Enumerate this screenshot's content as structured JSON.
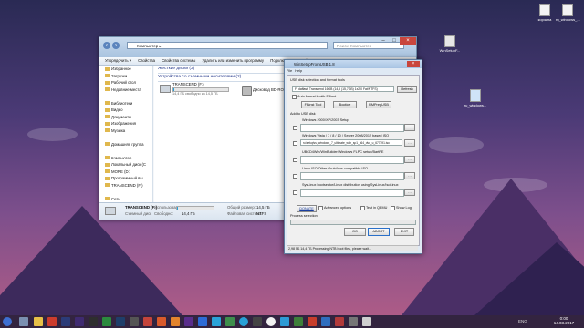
{
  "desktop": {
    "icons": [
      {
        "label": "корзина",
        "name": "recycle-bin-icon"
      },
      {
        "label": "ru_windows_...",
        "name": "file-icon"
      },
      {
        "label": "WinSetupF...",
        "name": "winsetup-desktop-icon"
      },
      {
        "label": "ru_windows...",
        "name": "file-icon-2"
      }
    ]
  },
  "explorer": {
    "address": "Компьютер ▸",
    "search_placeholder": "Поиск: Компьютер",
    "toolbar": [
      "Упорядочить ▾",
      "Свойства",
      "Свойства системы",
      "Удалить или изменить программу",
      "Подключить сетевой диск",
      "»"
    ],
    "sidebar": [
      "Избранное",
      "Загрузки",
      "Рабочий стол",
      "Недавние места",
      "",
      "Библиотеки",
      "Видео",
      "Документы",
      "Изображения",
      "Музыка",
      "",
      "Домашняя группа",
      "",
      "Компьютер",
      "Локальный диск (C",
      "MORE (D:)",
      "Программный вы",
      "TRANSCEND (F:)",
      "",
      "Сеть"
    ],
    "groups": {
      "hdd": "Жесткие диски (3)",
      "removable": "Устройства со съемными носителями (2)"
    },
    "drive": {
      "name": "TRANSCEND (F:)",
      "free": "14,4 ГБ свободно из 14,5 ГБ"
    },
    "dvd": "Дисковод BD-ROM (",
    "status": {
      "name": "TRANSCEND (F:)",
      "type": "Съемный диск",
      "used_label": "Использовано:",
      "free_label": "Свободно:",
      "free": "14,4 ГБ",
      "total_label": "Общий размер:",
      "total": "14,5 ГБ",
      "fs_label": "Файловая система:",
      "fs": "NTFS"
    }
  },
  "wsfu": {
    "title": "WinSetupFromUSB 1.8",
    "menu": [
      "File",
      "Help"
    ],
    "section1": "USB disk selection and format tools",
    "disk": "F: daffast: Transcend 16GB (14,5 (15,7GB) 1x2,0 Fat/NTFS)",
    "refresh": "Refresh",
    "autoformat": "Auto format it with FBinst",
    "tools": [
      "FBinst Tool",
      "Bootice",
      "RMPrepUSB"
    ],
    "section2": "Add to USB disk",
    "options": [
      {
        "label": "Windows 2000/XP/2003 Setup",
        "value": ""
      },
      {
        "label": "Windows Vista / 7 / 8 / 10 / Server 2008/2012 based ISO",
        "value": "ru\\setup\\ru_windows_7_ultimate_with_sp1_x64_dvd_u_677391.iso"
      },
      {
        "label": "UBCD4Win/WinBuilder/Windows FLPC setup/BartPE",
        "value": ""
      },
      {
        "label": "Linux ISO/Other Grub4dos compatible ISO",
        "value": ""
      },
      {
        "label": "SysLinux bootsector/Linux distribution using SysLinux/IsoLinux",
        "value": ""
      }
    ],
    "donate": "DONATE",
    "advanced": "Advanced options",
    "test_qemu": "Test in QEMU",
    "show_log": "Show Log",
    "progress_label": "Process selection",
    "go": "GO",
    "abort": "ABORT",
    "exit": "EXIT",
    "status": "2,98 ГБ   14,4 ГБ   Processing NTB boot files, please wait..."
  },
  "taskbar": {
    "lang": "ENG",
    "time": "0:00",
    "date": "14.03.2017"
  },
  "colors": {
    "accent": "#2a5fb0",
    "close": "#c9463d"
  }
}
